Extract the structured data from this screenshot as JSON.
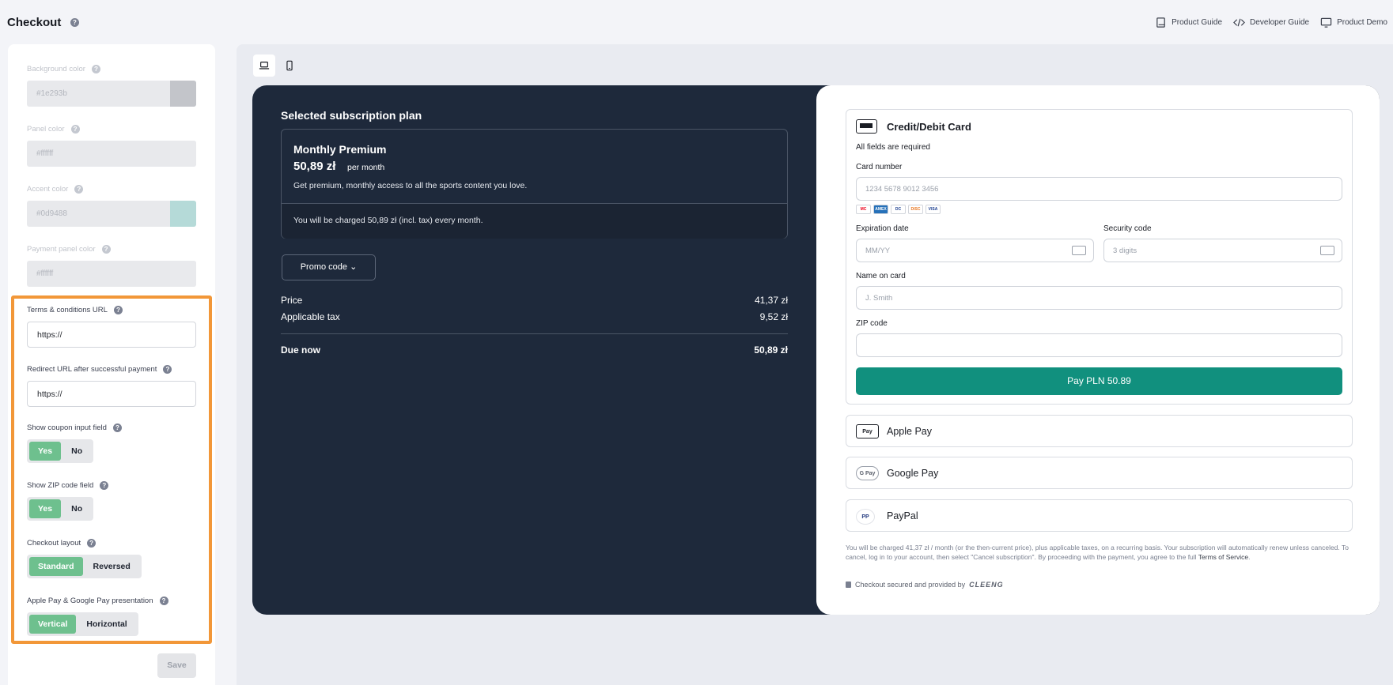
{
  "header": {
    "title": "Checkout",
    "links": [
      "Product Guide",
      "Developer Guide",
      "Product Demo"
    ]
  },
  "settings": {
    "bg_color": {
      "label": "Background color",
      "value": "#1e293b",
      "swatch": "#c3c5ca"
    },
    "panel_color": {
      "label": "Panel color",
      "value": "#ffffff",
      "swatch": "#e9eaed"
    },
    "accent_color": {
      "label": "Accent color",
      "value": "#0d9488",
      "swatch": "#b5dad8"
    },
    "payment_panel_color": {
      "label": "Payment panel color",
      "value": "#ffffff",
      "swatch": "#e9eaed"
    },
    "terms_url": {
      "label": "Terms & conditions URL",
      "value": "https://"
    },
    "redirect_url": {
      "label": "Redirect URL after successful payment",
      "value": "https://"
    },
    "coupon": {
      "label": "Show coupon input field",
      "options": [
        "Yes",
        "No"
      ],
      "selected": "Yes"
    },
    "zip": {
      "label": "Show ZIP code field",
      "options": [
        "Yes",
        "No"
      ],
      "selected": "Yes"
    },
    "layout": {
      "label": "Checkout layout",
      "options": [
        "Standard",
        "Reversed"
      ],
      "selected": "Standard"
    },
    "wallet_presentation": {
      "label": "Apple Pay & Google Pay presentation",
      "options": [
        "Vertical",
        "Horizontal"
      ],
      "selected": "Vertical"
    },
    "save_label": "Save"
  },
  "preview": {
    "plan_title": "Selected subscription plan",
    "plan": {
      "name": "Monthly Premium",
      "price": "50,89 zł",
      "period": "per month",
      "description": "Get premium, monthly access to all the sports content you love.",
      "charge_note": "You will be charged 50,89 zł (incl. tax) every month."
    },
    "promo_label": "Promo code ⌄",
    "summary": {
      "price_label": "Price",
      "price_value": "41,37 zł",
      "tax_label": "Applicable tax",
      "tax_value": "9,52 zł",
      "due_label": "Due now",
      "due_value": "50,89 zł"
    },
    "card": {
      "title": "Credit/Debit Card",
      "required_note": "All fields are required",
      "number_label": "Card number",
      "number_placeholder": "1234 5678 9012 3456",
      "expiry_label": "Expiration date",
      "expiry_placeholder": "MM/YY",
      "cvc_label": "Security code",
      "cvc_placeholder": "3 digits",
      "name_label": "Name on card",
      "name_placeholder": "J. Smith",
      "zip_label": "ZIP code",
      "zip_placeholder": "",
      "pay_label": "Pay PLN 50.89",
      "brands": [
        "MC",
        "AMEX",
        "DC",
        "DISC",
        "VISA"
      ]
    },
    "methods": [
      {
        "logo": "Pay",
        "label": "Apple Pay"
      },
      {
        "logo": "G Pay",
        "label": "Google Pay"
      },
      {
        "logo": "PP",
        "label": "PayPal"
      }
    ],
    "legal": "You will be charged 41,37 zł / month (or the then-current price), plus applicable taxes, on a recurring basis. Your subscription will automatically renew unless canceled. To cancel, log in to your account, then select \"Cancel subscription\". By proceeding with the payment, you agree to the full",
    "legal_link": "Terms of Service",
    "secured": "Checkout secured and provided by",
    "secured_brand": "CLEENG"
  },
  "colors": {
    "accent": "#11907e",
    "dark_bg": "#1e293b",
    "highlight": "#f29738",
    "toggle_on": "#6ec08e"
  }
}
